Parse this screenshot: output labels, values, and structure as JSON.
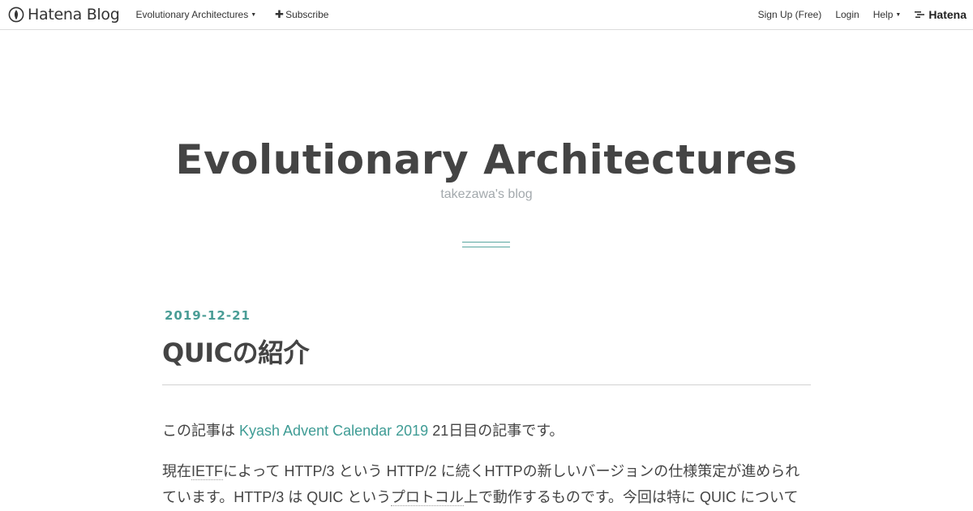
{
  "topbar": {
    "brand": "Hatena Blog",
    "blog_menu": "Evolutionary Architectures",
    "subscribe": "Subscribe",
    "signup": "Sign Up (Free)",
    "login": "Login",
    "help": "Help",
    "hatena": "Hatena"
  },
  "header": {
    "title": "Evolutionary Architectures",
    "description": "takezawa's blog"
  },
  "entry": {
    "date": "2019-12-21",
    "title": "QUICの紹介",
    "p1": {
      "before": "この記事は ",
      "link": "Kyash Advent Calendar 2019",
      "after": " 21日目の記事です。"
    },
    "p2": {
      "s1": "現在",
      "kw1": "IETF",
      "s2": "によって HTTP/3 という HTTP/2 に続くHTTPの新しいバージョンの仕様策定が進められています。HTTP/3 は QUIC という",
      "kw2": "プロトコル",
      "s3": "上で動作するものです。今回は特に QUIC について"
    }
  },
  "colors": {
    "accent": "#4a9d96",
    "text": "#444444",
    "muted": "#a3a9ad"
  }
}
